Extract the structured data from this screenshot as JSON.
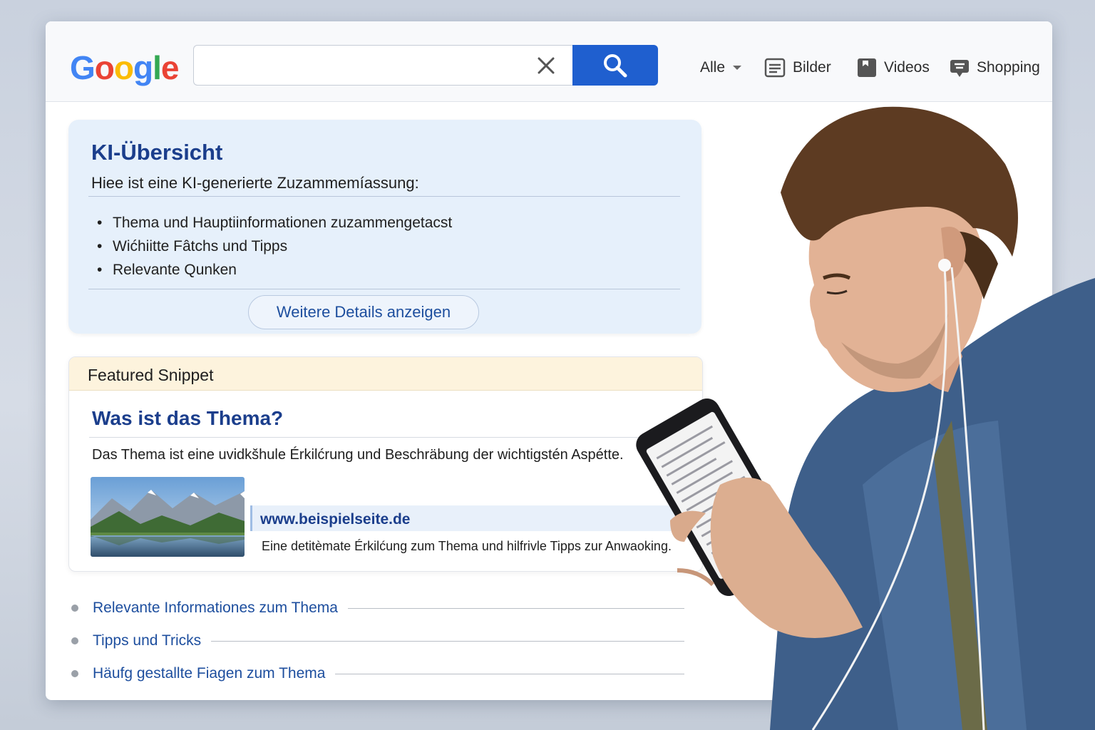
{
  "header": {
    "logo_text": "Google",
    "search": {
      "value": "",
      "placeholder": ""
    },
    "tabs": [
      {
        "label": "Alle",
        "icon": "chevron-down-icon"
      },
      {
        "label": "Bilder",
        "icon": "image-icon"
      },
      {
        "label": "Videos",
        "icon": "video-icon"
      },
      {
        "label": "Shopping",
        "icon": "shopping-tag-icon"
      }
    ]
  },
  "ai_overview": {
    "title": "KI-Übersicht",
    "subtitle": "Hiee ist eine KI-generierte Zuzammemíassung:",
    "items": [
      "Thema und Hauptiinformationen zuzammengetacst",
      "Wićhiitte Fâtchs und Tipps",
      "Relevante Qunken"
    ],
    "details_button": "Weitere Details anzeigen"
  },
  "featured_snippet": {
    "header": "Featured Snippet",
    "question": "Was ist das Thema?",
    "description": "Das Thema ist eine uvidkšhule Érkilćrung und Beschräbung der wichtigstén Aspétte.",
    "url": "www.beispielseite.de",
    "url_description": "Eine detitèmate Érkilćung zum Thema und hilfrivle Tipps zur Anwaoking."
  },
  "related_links": [
    "Relevante Informationes zum Thema",
    "Tipps und Tricks",
    "Häufg gestallte Fiagen zum Thema"
  ],
  "colors": {
    "brand_blue": "#1f5fcf",
    "title_blue": "#1b3e8c",
    "ai_card_bg": "#e6f0fb",
    "snippet_header_bg": "#fdf3dd"
  }
}
